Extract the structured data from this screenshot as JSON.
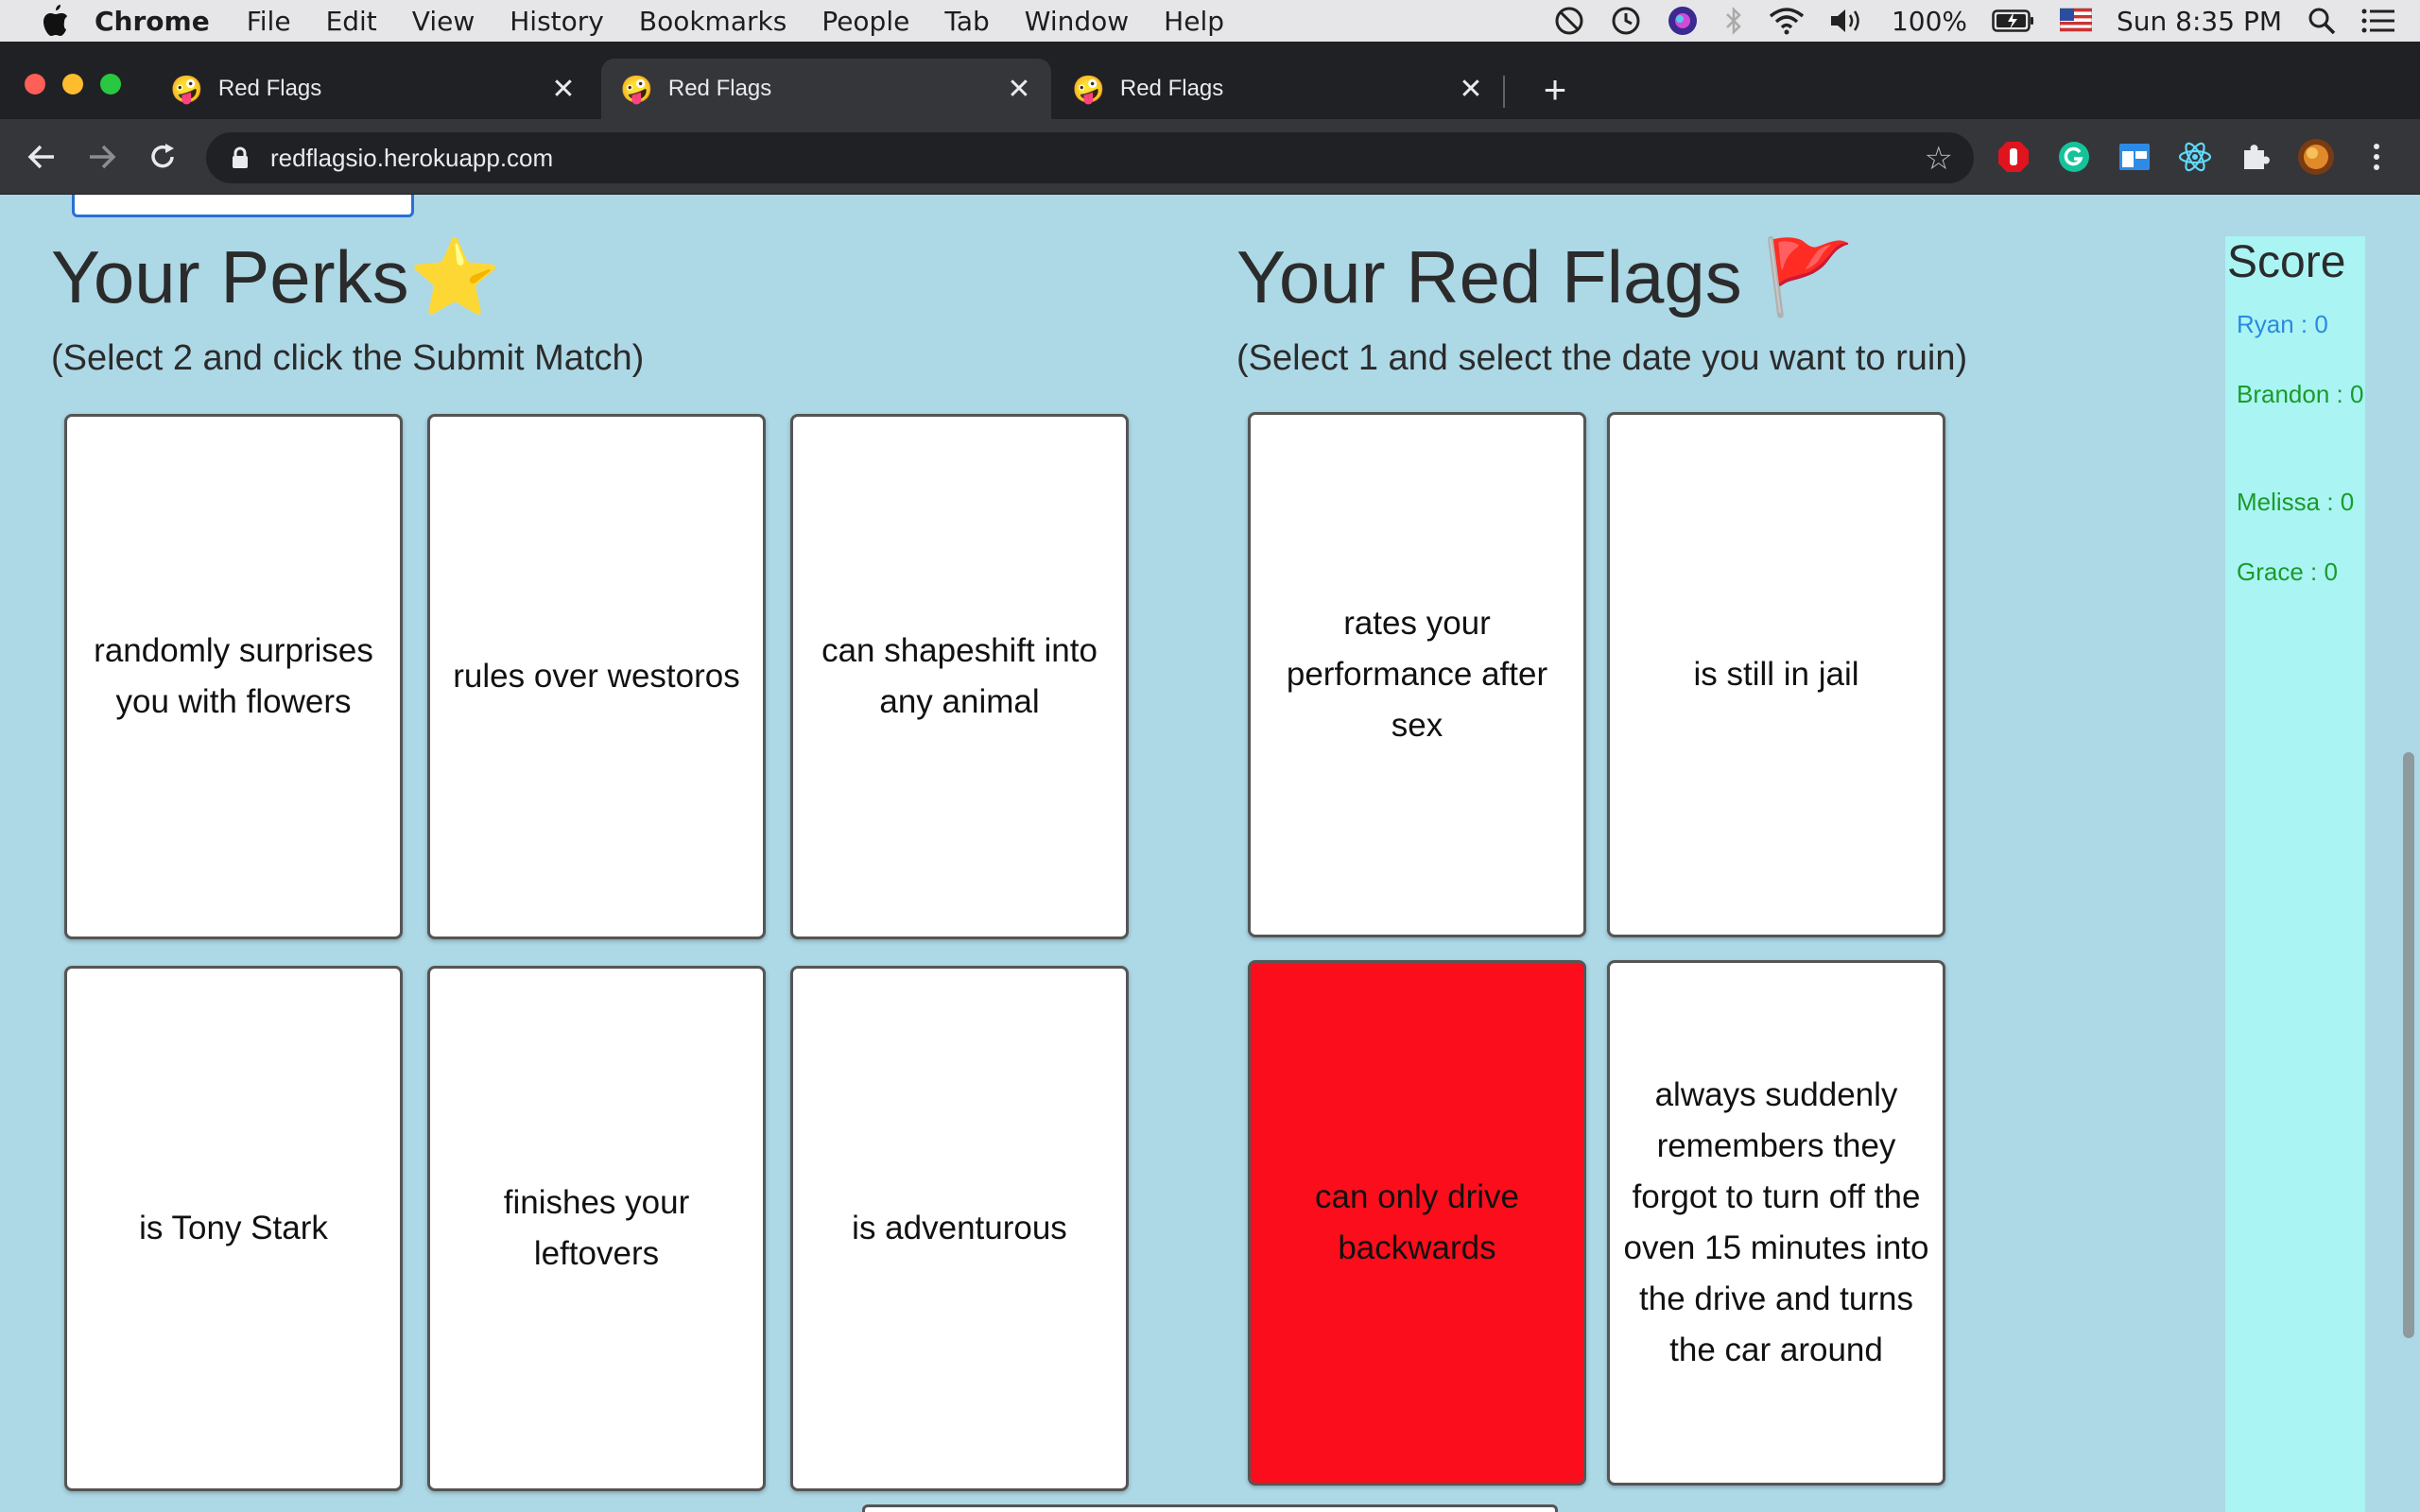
{
  "menubar": {
    "app_name": "Chrome",
    "items": [
      "File",
      "Edit",
      "View",
      "History",
      "Bookmarks",
      "People",
      "Tab",
      "Window",
      "Help"
    ],
    "battery": "100%",
    "clock": "Sun 8:35 PM"
  },
  "tabs": [
    {
      "title": "Red Flags",
      "favicon": "🤪",
      "active": false
    },
    {
      "title": "Red Flags",
      "favicon": "🤪",
      "active": true
    },
    {
      "title": "Red Flags",
      "favicon": "🤪",
      "active": false
    }
  ],
  "toolbar": {
    "url": "redflagsio.herokuapp.com"
  },
  "perks": {
    "title": "Your Perks⭐",
    "subtitle": "(Select 2 and click the Submit Match)",
    "cards": [
      "randomly surprises you with flowers",
      "rules over westoros",
      "can shapeshift into any animal",
      "is Tony Stark",
      "finishes your leftovers",
      "is adventurous"
    ]
  },
  "red_flags": {
    "title": "Your Red Flags 🚩",
    "subtitle": "(Select 1 and select the date you want to ruin)",
    "cards": [
      {
        "text": "rates your performance after sex",
        "selected": false
      },
      {
        "text": "is still in jail",
        "selected": false
      },
      {
        "text": "can only drive backwards",
        "selected": true
      },
      {
        "text": "always suddenly remembers they forgot to turn off the oven 15 minutes into the drive and turns the car around",
        "selected": false
      }
    ],
    "selected_color": "#fb0d1b"
  },
  "score": {
    "title": "Score",
    "players": [
      {
        "name": "Ryan",
        "text": "Ryan : 0",
        "color": "#2b8ae0"
      },
      {
        "name": "Brandon",
        "text": "Brandon : 0",
        "color": "#1a9b2a"
      },
      {
        "name": "Melissa",
        "text": "Melissa : 0",
        "color": "#1a9b2a"
      },
      {
        "name": "Grace",
        "text": "Grace : 0",
        "color": "#1a9b2a"
      }
    ]
  },
  "icons": [
    "apple-icon",
    "back-icon",
    "forward-icon",
    "reload-icon",
    "lock-icon",
    "star-icon",
    "puzzle-icon",
    "wifi-icon",
    "volume-icon",
    "battery-icon",
    "search-icon",
    "control-center-icon"
  ]
}
